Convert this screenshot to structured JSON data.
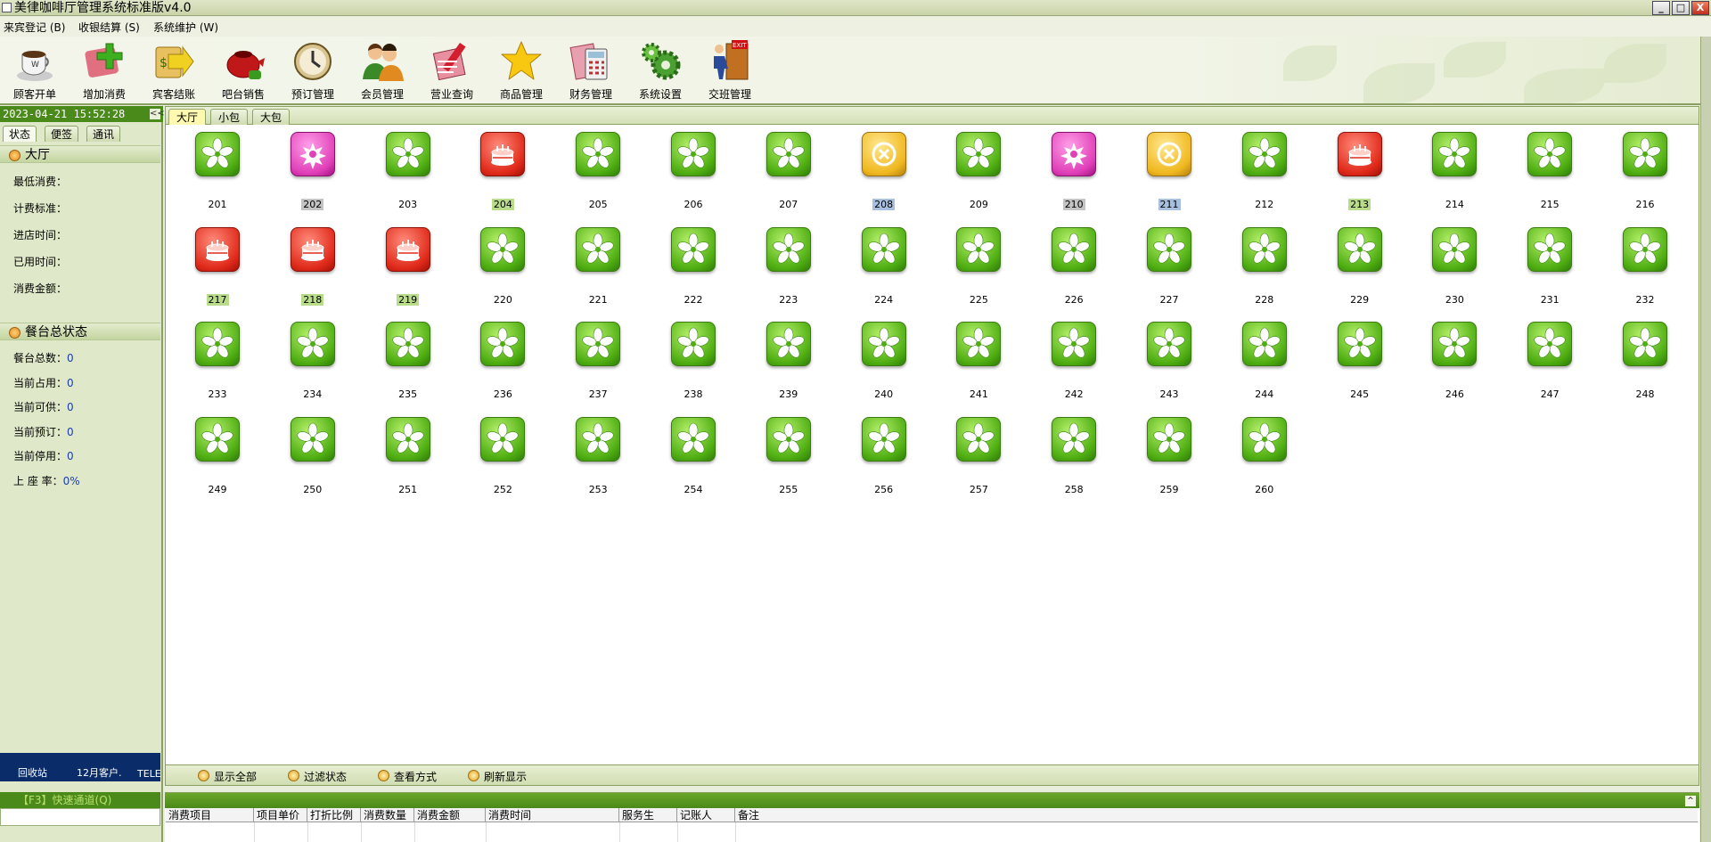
{
  "window": {
    "title": "美律咖啡厅管理系统标准版v4.0",
    "buttons": [
      "_",
      "□",
      "X"
    ]
  },
  "menu": [
    "来宾登记 (B)",
    "收银结算 (S)",
    "系统维护 (W)"
  ],
  "toolbar": [
    {
      "label": "顾客开单",
      "icon": "coffee-cup-icon"
    },
    {
      "label": "增加消费",
      "icon": "add-cross-icon"
    },
    {
      "label": "宾客结账",
      "icon": "arrow-checkout-icon"
    },
    {
      "label": "吧台销售",
      "icon": "teapot-icon"
    },
    {
      "label": "预订管理",
      "icon": "clock-icon"
    },
    {
      "label": "会员管理",
      "icon": "members-icon"
    },
    {
      "label": "营业查询",
      "icon": "search-pen-icon"
    },
    {
      "label": "商品管理",
      "icon": "star-icon"
    },
    {
      "label": "财务管理",
      "icon": "calculator-icon"
    },
    {
      "label": "系统设置",
      "icon": "gears-icon"
    },
    {
      "label": "交班管理",
      "icon": "exit-door-icon"
    }
  ],
  "left": {
    "datetime": "2023-04-21 15:52:28",
    "collapse": "<<",
    "tabs": [
      "状态",
      "便签",
      "通讯"
    ],
    "hall_title": "大厅",
    "hall_fields": [
      "最低消费：",
      "计费标准：",
      "进店时间：",
      "已用时间：",
      "消费金额："
    ],
    "summary_title": "餐台总状态",
    "summary": [
      {
        "label": "餐台总数：",
        "value": "0"
      },
      {
        "label": "当前占用：",
        "value": "0"
      },
      {
        "label": "当前可供：",
        "value": "0"
      },
      {
        "label": "当前预订：",
        "value": "0"
      },
      {
        "label": "当前停用：",
        "value": "0"
      },
      {
        "label": "上 座 率：",
        "value": "0%"
      }
    ],
    "desktop": [
      "回收站",
      "12月客户.",
      "TELE"
    ],
    "quick_channel": "【F3】快速通道(Q)"
  },
  "main": {
    "tabs": [
      "大厅",
      "小包",
      "大包"
    ],
    "tables": [
      {
        "n": "201",
        "s": "free"
      },
      {
        "n": "202",
        "s": "reserved",
        "h": "gray"
      },
      {
        "n": "203",
        "s": "free"
      },
      {
        "n": "204",
        "s": "occupied",
        "h": "green"
      },
      {
        "n": "205",
        "s": "free"
      },
      {
        "n": "206",
        "s": "free"
      },
      {
        "n": "207",
        "s": "free"
      },
      {
        "n": "208",
        "s": "stopped",
        "h": "blue"
      },
      {
        "n": "209",
        "s": "free"
      },
      {
        "n": "210",
        "s": "reserved",
        "h": "gray"
      },
      {
        "n": "211",
        "s": "stopped",
        "h": "blue"
      },
      {
        "n": "212",
        "s": "free"
      },
      {
        "n": "213",
        "s": "occupied",
        "h": "green"
      },
      {
        "n": "214",
        "s": "free"
      },
      {
        "n": "215",
        "s": "free"
      },
      {
        "n": "216",
        "s": "free"
      },
      {
        "n": "217",
        "s": "occupied",
        "h": "green"
      },
      {
        "n": "218",
        "s": "occupied",
        "h": "green"
      },
      {
        "n": "219",
        "s": "occupied",
        "h": "green"
      },
      {
        "n": "220",
        "s": "free"
      },
      {
        "n": "221",
        "s": "free"
      },
      {
        "n": "222",
        "s": "free"
      },
      {
        "n": "223",
        "s": "free"
      },
      {
        "n": "224",
        "s": "free"
      },
      {
        "n": "225",
        "s": "free"
      },
      {
        "n": "226",
        "s": "free"
      },
      {
        "n": "227",
        "s": "free"
      },
      {
        "n": "228",
        "s": "free"
      },
      {
        "n": "229",
        "s": "free"
      },
      {
        "n": "230",
        "s": "free"
      },
      {
        "n": "231",
        "s": "free"
      },
      {
        "n": "232",
        "s": "free"
      },
      {
        "n": "233",
        "s": "free"
      },
      {
        "n": "234",
        "s": "free"
      },
      {
        "n": "235",
        "s": "free"
      },
      {
        "n": "236",
        "s": "free"
      },
      {
        "n": "237",
        "s": "free"
      },
      {
        "n": "238",
        "s": "free"
      },
      {
        "n": "239",
        "s": "free"
      },
      {
        "n": "240",
        "s": "free"
      },
      {
        "n": "241",
        "s": "free"
      },
      {
        "n": "242",
        "s": "free"
      },
      {
        "n": "243",
        "s": "free"
      },
      {
        "n": "244",
        "s": "free"
      },
      {
        "n": "245",
        "s": "free"
      },
      {
        "n": "246",
        "s": "free"
      },
      {
        "n": "247",
        "s": "free"
      },
      {
        "n": "248",
        "s": "free"
      },
      {
        "n": "249",
        "s": "free"
      },
      {
        "n": "250",
        "s": "free"
      },
      {
        "n": "251",
        "s": "free"
      },
      {
        "n": "252",
        "s": "free"
      },
      {
        "n": "253",
        "s": "free"
      },
      {
        "n": "254",
        "s": "free"
      },
      {
        "n": "255",
        "s": "free"
      },
      {
        "n": "256",
        "s": "free"
      },
      {
        "n": "257",
        "s": "free"
      },
      {
        "n": "258",
        "s": "free"
      },
      {
        "n": "259",
        "s": "free"
      },
      {
        "n": "260",
        "s": "free"
      }
    ]
  },
  "bottom_bar": [
    "显示全部",
    "过滤状态",
    "查看方式",
    "刷新显示"
  ],
  "detail": {
    "expand": "^",
    "columns": [
      "消费项目",
      "项目单价",
      "打折比例",
      "消费数量",
      "消费金额",
      "消费时间",
      "服务生",
      "记账人",
      "备注"
    ]
  },
  "colors": {
    "accent": "#4a8a1a",
    "free": "#4fae12",
    "occupied": "#e02a1a",
    "reserved": "#e040b8",
    "stopped": "#f0b820"
  }
}
